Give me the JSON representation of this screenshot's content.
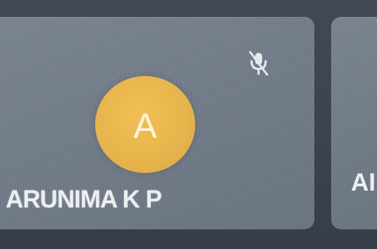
{
  "participants": [
    {
      "initial": "A",
      "name": "ARUNIMA K P",
      "avatar_color": "#E8B54D",
      "muted": true,
      "status_icon": "mic-off-icon"
    },
    {
      "name_partial": "AI"
    }
  ]
}
